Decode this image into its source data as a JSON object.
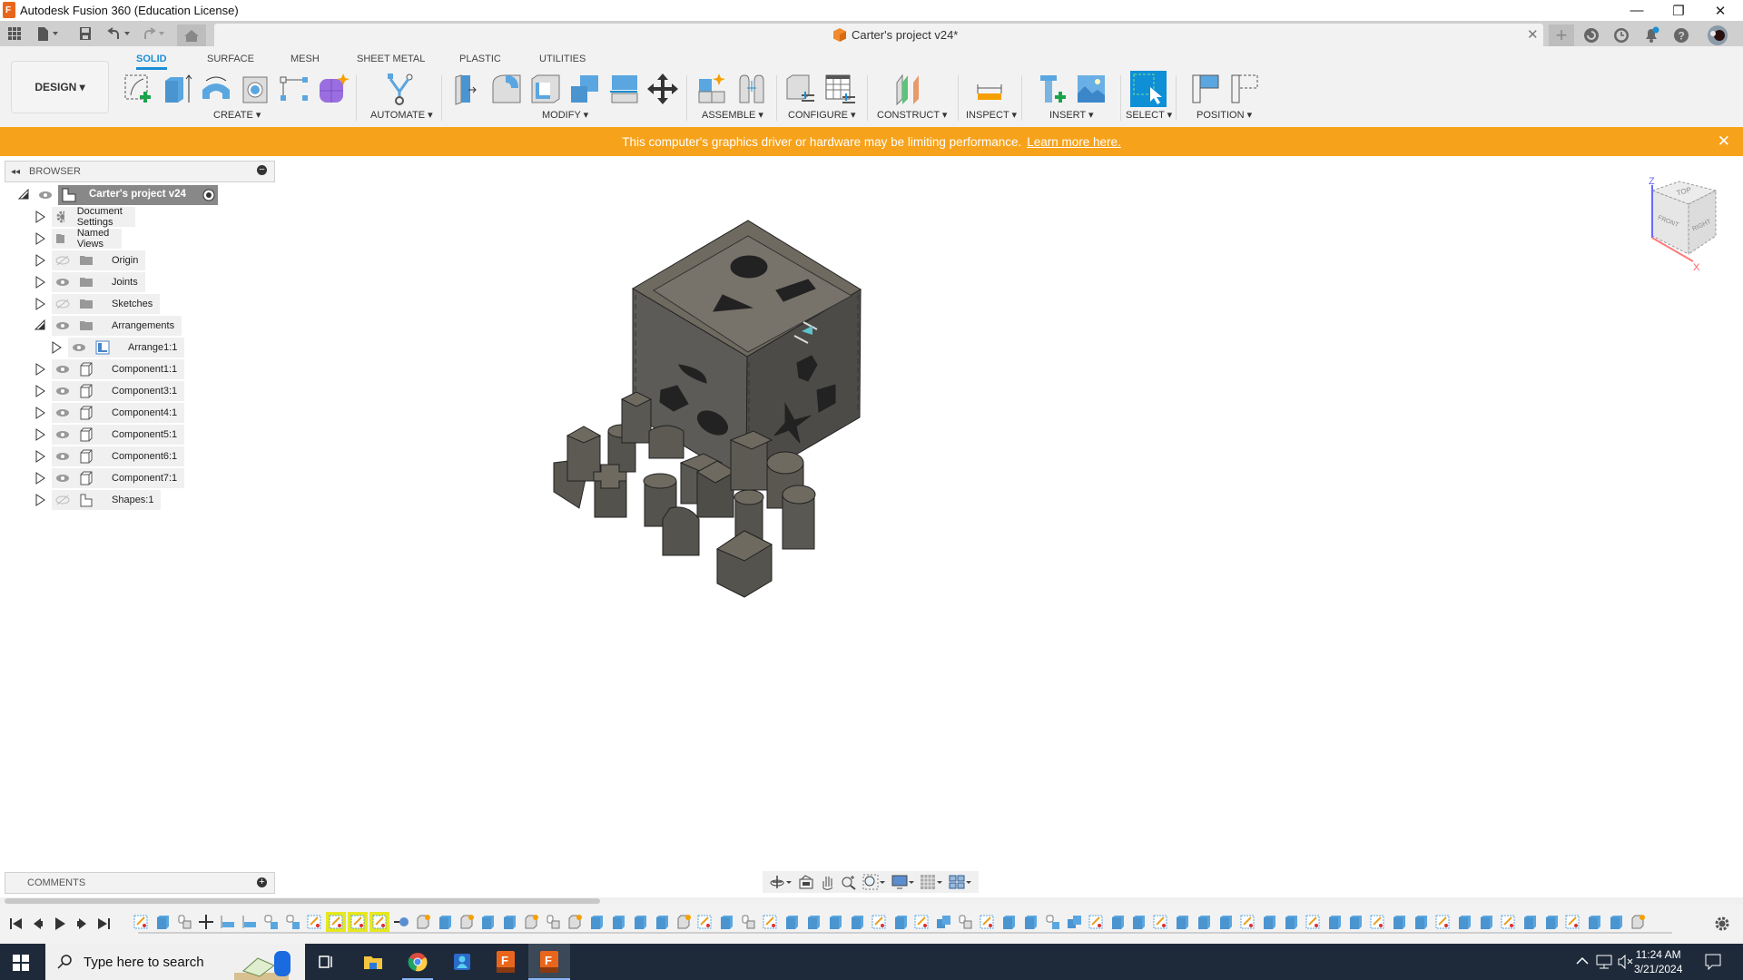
{
  "window": {
    "title": "Autodesk Fusion 360 (Education License)",
    "controls": [
      "minimize",
      "restore",
      "close"
    ]
  },
  "document_tab": {
    "title": "Carter's project v24*"
  },
  "quick_access": [
    "grid-icon",
    "file-icon",
    "save-icon",
    "undo-icon",
    "redo-icon",
    "home-icon"
  ],
  "top_right_icons": [
    "new-tab-icon",
    "extensions-icon",
    "job-status-icon",
    "notifications-icon",
    "help-icon",
    "user-avatar"
  ],
  "toolbar": {
    "workspace": "DESIGN",
    "tabs": [
      {
        "label": "SOLID",
        "active": true
      },
      {
        "label": "SURFACE"
      },
      {
        "label": "MESH"
      },
      {
        "label": "SHEET METAL"
      },
      {
        "label": "PLASTIC"
      },
      {
        "label": "UTILITIES"
      }
    ],
    "groups": [
      {
        "label": "CREATE",
        "tools": [
          "create-sketch",
          "extrude",
          "revolve",
          "hole",
          "pattern",
          "create-form"
        ]
      },
      {
        "label": "AUTOMATE",
        "tools": [
          "automated-modeling"
        ]
      },
      {
        "label": "MODIFY",
        "tools": [
          "press-pull",
          "fillet",
          "shell",
          "combine",
          "offset-face",
          "move-copy"
        ]
      },
      {
        "label": "ASSEMBLE",
        "tools": [
          "new-component",
          "joint"
        ]
      },
      {
        "label": "CONFIGURE",
        "tools": [
          "configure-model",
          "configuration-table"
        ]
      },
      {
        "label": "CONSTRUCT",
        "tools": [
          "midplane"
        ]
      },
      {
        "label": "INSPECT",
        "tools": [
          "measure"
        ]
      },
      {
        "label": "INSERT",
        "tools": [
          "insert-mcmaster",
          "insert-canvas"
        ]
      },
      {
        "label": "SELECT",
        "tools": [
          "select"
        ]
      },
      {
        "label": "POSITION",
        "tools": [
          "capture-position",
          "revert-position"
        ]
      }
    ]
  },
  "banner": {
    "message": "This computer's graphics driver or hardware may be limiting performance.",
    "link": "Learn more here.",
    "color": "#f7a21b"
  },
  "browser": {
    "title": "BROWSER",
    "root": {
      "label": "Carter's project v24"
    },
    "items": [
      {
        "label": "Document Settings",
        "icon": "gear",
        "eye": "none",
        "expanded": false,
        "level": 1
      },
      {
        "label": "Named Views",
        "icon": "folder",
        "eye": "none",
        "expanded": false,
        "level": 1
      },
      {
        "label": "Origin",
        "icon": "folder",
        "eye": "hidden",
        "expanded": false,
        "level": 1
      },
      {
        "label": "Joints",
        "icon": "folder",
        "eye": "visible",
        "expanded": false,
        "level": 1
      },
      {
        "label": "Sketches",
        "icon": "folder",
        "eye": "hidden",
        "expanded": false,
        "level": 1
      },
      {
        "label": "Arrangements",
        "icon": "folder",
        "eye": "visible",
        "expanded": true,
        "level": 1
      },
      {
        "label": "Arrange1:1",
        "icon": "arrange",
        "eye": "visible",
        "expanded": false,
        "level": 2
      },
      {
        "label": "Component1:1",
        "icon": "component",
        "eye": "visible",
        "expanded": false,
        "level": 1
      },
      {
        "label": "Component3:1",
        "icon": "component",
        "eye": "visible",
        "expanded": false,
        "level": 1
      },
      {
        "label": "Component4:1",
        "icon": "component",
        "eye": "visible",
        "expanded": false,
        "level": 1
      },
      {
        "label": "Component5:1",
        "icon": "component",
        "eye": "visible",
        "expanded": false,
        "level": 1
      },
      {
        "label": "Component6:1",
        "icon": "component",
        "eye": "visible",
        "expanded": false,
        "level": 1
      },
      {
        "label": "Component7:1",
        "icon": "component",
        "eye": "visible",
        "expanded": false,
        "level": 1
      },
      {
        "label": "Shapes:1",
        "icon": "shapes",
        "eye": "hidden",
        "expanded": false,
        "level": 1
      }
    ]
  },
  "viewcube": {
    "faces": [
      "TOP",
      "FRONT",
      "RIGHT"
    ],
    "axes": [
      "Z",
      "X"
    ]
  },
  "comments": {
    "title": "COMMENTS"
  },
  "nav_bar": [
    "orbit-icon",
    "look-at-icon",
    "pan-icon",
    "zoom-icon",
    "fit-icon",
    "display-settings-icon",
    "grid-icon",
    "viewports-icon"
  ],
  "timeline": {
    "controls": [
      "first",
      "previous",
      "play",
      "next",
      "last"
    ],
    "features": [
      "sketch",
      "extrude",
      "joint",
      "move",
      "align",
      "align",
      "rigid",
      "rigid",
      "sketch",
      "sketch-hl",
      "sketch-hl",
      "sketch-hl",
      "point",
      "component",
      "extrude",
      "component",
      "extrude",
      "extrude",
      "component",
      "joint",
      "component",
      "extrude",
      "extrude",
      "extrude",
      "extrude",
      "component",
      "sketch",
      "extrude",
      "joint",
      "sketch",
      "extrude",
      "extrude",
      "extrude",
      "extrude",
      "sketch",
      "extrude",
      "sketch",
      "combine",
      "joint",
      "sketch",
      "extrude",
      "extrude",
      "rigid",
      "combine",
      "sketch",
      "extrude",
      "extrude",
      "sketch",
      "extrude",
      "extrude",
      "extrude",
      "sketch",
      "extrude",
      "extrude",
      "sketch",
      "extrude",
      "extrude",
      "sketch",
      "extrude",
      "extrude",
      "sketch",
      "extrude",
      "extrude",
      "sketch",
      "extrude",
      "extrude",
      "sketch",
      "extrude",
      "extrude",
      "component"
    ]
  },
  "taskbar": {
    "search_placeholder": "Type here to search",
    "apps": [
      "task-view",
      "file-explorer",
      "chrome",
      "teams",
      "fusion-360",
      "fusion-360-active"
    ],
    "time": "11:24 AM",
    "date": "3/21/2024"
  }
}
